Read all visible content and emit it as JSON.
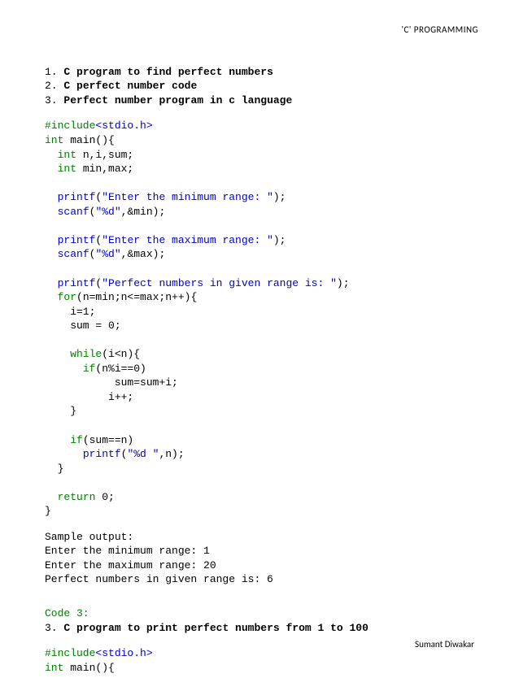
{
  "header": "'C' PROGRAMMING",
  "footer": "Sumant Diwakar",
  "list": {
    "n1": "1.",
    "t1": "C program to find perfect numbers",
    "n2": "2.",
    "t2": "C perfect number code",
    "n3": "3.",
    "t3": "Perfect number program in c language"
  },
  "c": {
    "include": "#include",
    "stdio": "<stdio.h>",
    "int": "int",
    "main": " main(){",
    "decl1": " n,i,sum;",
    "decl2": " min,max;",
    "printf": "printf",
    "scanf": "scanf",
    "for": "for",
    "while": "while",
    "if": "if",
    "return": "return",
    "s_min": "\"Enter the minimum range: \"",
    "s_max": "\"Enter the maximum range: \"",
    "s_perf": "\"Perfect numbers in given range is: \"",
    "fmt_d": "\"%d\"",
    "fmt_dsp": "\"%d \"",
    "min_arg": ",&min);",
    "max_arg": ",&max);",
    "for_args": "(n=min;n<=max;n++){",
    "i1": "    i=1;",
    "sum0": "    sum = 0;",
    "while_arg": "(i<n){",
    "if_arg": "(n%i==0)",
    "sumline": "           sum=sum+i;",
    "ipp": "          i++;",
    "brace": "    }",
    "brace2": "  }",
    "if2_arg": "(sum==n)",
    "n_arg": ",n);",
    "ret0": " 0;",
    "endbrace": "}",
    "close_paren": ");"
  },
  "sample": {
    "h": "Sample output:",
    "l1": "Enter the minimum range: 1",
    "l2": "Enter the maximum range: 20",
    "l3": "Perfect numbers in given range is: 6"
  },
  "code3": {
    "label": "Code 3:",
    "num": "3.",
    "title": "C program to print perfect numbers from 1 to 100"
  }
}
